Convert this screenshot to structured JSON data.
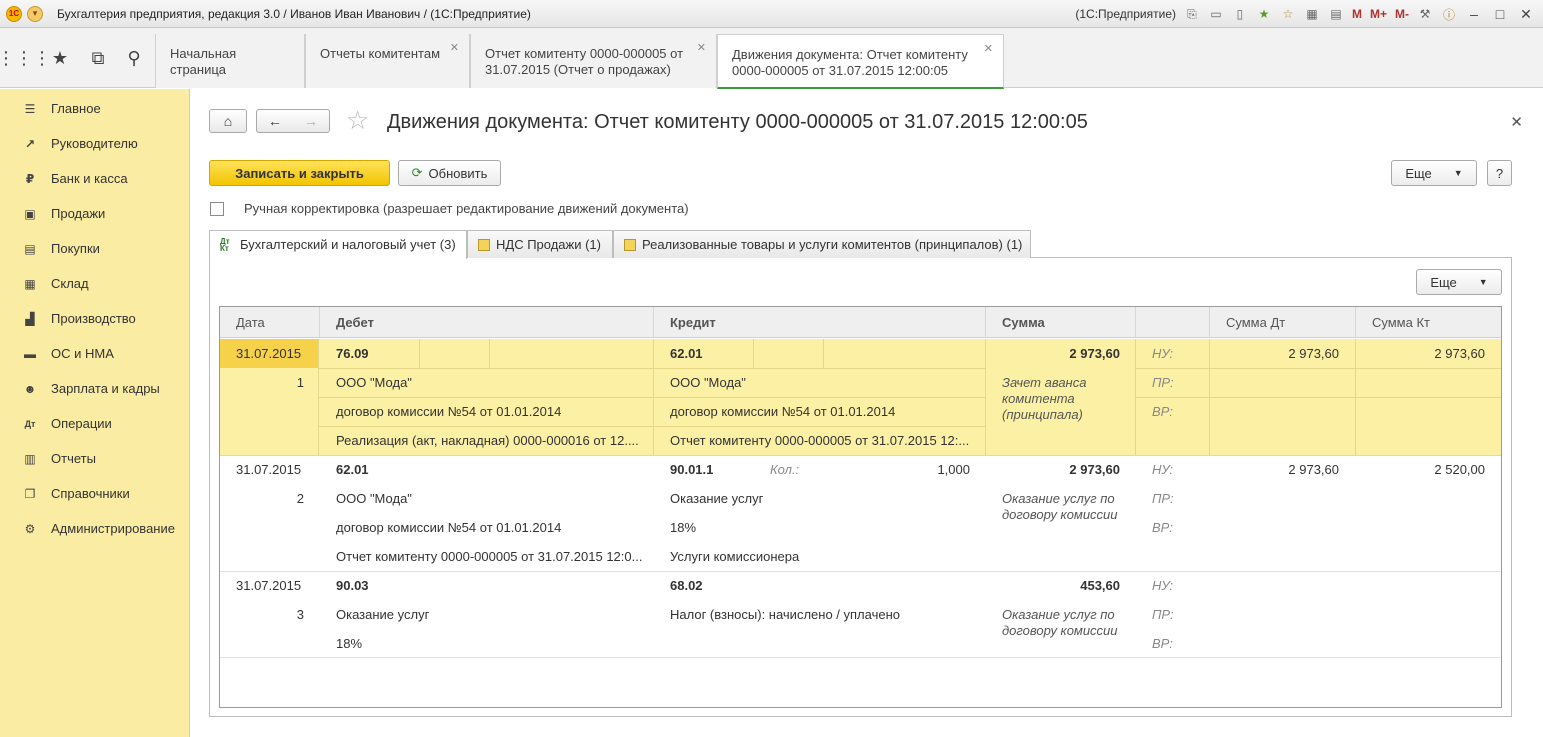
{
  "titlebar": {
    "title": "Бухгалтерия предприятия, редакция 3.0 / Иванов Иван Иванович / (1С:Предприятие)",
    "platform": "(1С:Предприятие)",
    "m": "M",
    "mplus": "M+",
    "mminus": "M-"
  },
  "open_tabs": [
    {
      "label": "Начальная страница"
    },
    {
      "label": "Отчеты комитентам"
    },
    {
      "label": "Отчет комитенту 0000-000005 от 31.07.2015 (Отчет о продажах)"
    },
    {
      "label": "Движения документа: Отчет комитенту 0000-000005 от 31.07.2015 12:00:05"
    }
  ],
  "sidebar": {
    "items": [
      {
        "label": "Главное",
        "icon": "menu-icon"
      },
      {
        "label": "Руководителю",
        "icon": "trend-icon"
      },
      {
        "label": "Банк и касса",
        "icon": "ruble-icon"
      },
      {
        "label": "Продажи",
        "icon": "bag-icon"
      },
      {
        "label": "Покупки",
        "icon": "cart-icon"
      },
      {
        "label": "Склад",
        "icon": "warehouse-icon"
      },
      {
        "label": "Производство",
        "icon": "factory-icon"
      },
      {
        "label": "ОС и НМА",
        "icon": "truck-icon"
      },
      {
        "label": "Зарплата и кадры",
        "icon": "people-icon"
      },
      {
        "label": "Операции",
        "icon": "dt-kt-icon"
      },
      {
        "label": "Отчеты",
        "icon": "chart-icon"
      },
      {
        "label": "Справочники",
        "icon": "book-icon"
      },
      {
        "label": "Администрирование",
        "icon": "gear-icon"
      }
    ]
  },
  "page": {
    "title": "Движения документа: Отчет комитенту 0000-000005 от 31.07.2015 12:00:05",
    "save_close": "Записать и закрыть",
    "refresh": "Обновить",
    "more": "Еще",
    "help": "?",
    "manual_edit": "Ручная корректировка (разрешает редактирование движений документа)"
  },
  "register_tabs": [
    {
      "label": "Бухгалтерский и налоговый учет (3)"
    },
    {
      "label": "НДС Продажи (1)"
    },
    {
      "label": "Реализованные товары и услуги комитентов (принципалов) (1)"
    }
  ],
  "grid": {
    "more": "Еще",
    "headers": [
      "Дата",
      "Дебет",
      "Кредит",
      "Сумма",
      "",
      "Сумма Дт",
      "Сумма Кт"
    ],
    "rows": [
      {
        "date": "31.07.2015",
        "num": "1",
        "debit": [
          "76.09",
          "ООО \"Мода\"",
          "договор комиссии №54 от 01.01.2014",
          "Реализация (акт, накладная) 0000-000016 от 12...."
        ],
        "credit": [
          "62.01",
          "ООО \"Мода\"",
          "договор комиссии №54 от 01.01.2014",
          "Отчет комитенту 0000-000005 от 31.07.2015 12:..."
        ],
        "credit_qty_label": "",
        "credit_qty": "",
        "sum": "2 973,60",
        "content": "Зачет аванса комитента (принципала)",
        "nu": "НУ:",
        "pr": "ПР:",
        "vr": "ВР:",
        "sum_dt": "2 973,60",
        "sum_kt": "2 973,60"
      },
      {
        "date": "31.07.2015",
        "num": "2",
        "debit": [
          "62.01",
          "ООО \"Мода\"",
          "договор комиссии №54 от 01.01.2014",
          "Отчет комитенту 0000-000005 от 31.07.2015 12:0..."
        ],
        "credit": [
          "90.01.1",
          "Оказание услуг",
          "18%",
          "Услуги комиссионера"
        ],
        "credit_qty_label": "Кол.:",
        "credit_qty": "1,000",
        "sum": "2 973,60",
        "content": "Оказание услуг по договору комиссии",
        "nu": "НУ:",
        "pr": "ПР:",
        "vr": "ВР:",
        "sum_dt": "2 973,60",
        "sum_kt": "2 520,00"
      },
      {
        "date": "31.07.2015",
        "num": "3",
        "debit": [
          "90.03",
          "Оказание услуг",
          "18%",
          ""
        ],
        "credit": [
          "68.02",
          "Налог (взносы): начислено / уплачено",
          "",
          ""
        ],
        "credit_qty_label": "",
        "credit_qty": "",
        "sum": "453,60",
        "content": "Оказание услуг по договору комиссии",
        "nu": "НУ:",
        "pr": "ПР:",
        "vr": "ВР:",
        "sum_dt": "",
        "sum_kt": ""
      }
    ]
  },
  "colors": {
    "sidebar": "#fbeca3",
    "selected_row": "#fcf0a5",
    "primary_button": "#f2c400",
    "active_tab_underline": "#3a9a3a"
  }
}
